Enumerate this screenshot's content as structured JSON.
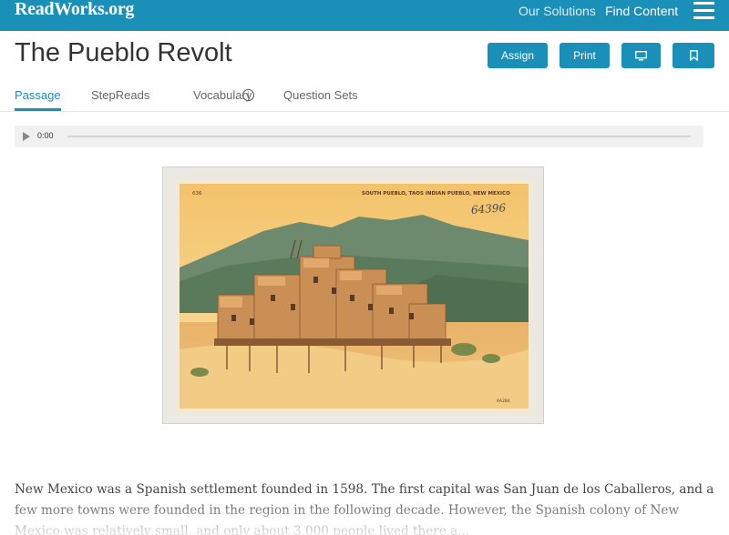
{
  "header": {
    "logo_text": "ReadWorks.org",
    "nav": {
      "solutions_label": "Our Solutions",
      "find_content_label": "Find Content"
    },
    "menu_icon": "hamburger-menu-icon"
  },
  "page": {
    "title": "The Pueblo Revolt",
    "actions": {
      "assign_label": "Assign",
      "print_label": "Print",
      "present_icon": "monitor-icon",
      "bookmark_icon": "bookmark-icon"
    }
  },
  "tabs": [
    {
      "label": "Passage",
      "active": true
    },
    {
      "label": "StepReads",
      "info_icon": "info-icon",
      "info_glyph": "i"
    },
    {
      "label": "Vocabulary"
    },
    {
      "label": "Question Sets"
    }
  ],
  "audio": {
    "time": "0:00",
    "play_icon": "play-icon",
    "progress": 0
  },
  "image": {
    "caption_on_card": "SOUTH PUEBLO, TAOS INDIAN PUEBLO, NEW MEXICO",
    "card_number": "636",
    "handwritten_number": "64396",
    "corner_code": "6A284"
  },
  "passage": {
    "text": "New Mexico was a Spanish settlement founded in 1598. The first capital was San Juan de los Caballeros, and a few more towns were founded in the region in the following decade. However, the Spanish colony of New Mexico was relatively small, and only about 3,000 people lived there a..."
  },
  "colors": {
    "brand": "#1a8fb8",
    "background": "#ffffff"
  }
}
